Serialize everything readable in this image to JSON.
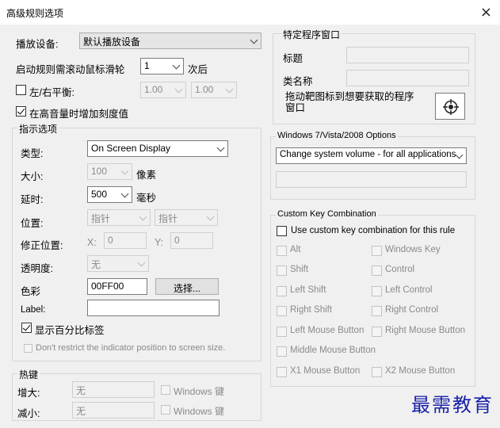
{
  "window": {
    "title": "高级规则选项",
    "close_glyph": "×"
  },
  "device": {
    "label": "播放设备:",
    "value": "默认播放设备"
  },
  "activation": {
    "prefix": "启动规则需滚动鼠标滑轮",
    "count": "1",
    "suffix": "次后"
  },
  "balance": {
    "label": "左/右平衡:",
    "checked": false,
    "left": "1.00",
    "right": "1.00"
  },
  "increase_scale": {
    "label": "在高音量时增加刻度值",
    "checked": true
  },
  "indicator": {
    "group_label": "指示选项",
    "type": {
      "label": "类型:",
      "value": "On Screen Display"
    },
    "size": {
      "label": "大小:",
      "value": "100",
      "unit": "像素"
    },
    "delay": {
      "label": "延时:",
      "value": "500",
      "unit": "毫秒"
    },
    "position": {
      "label": "位置:",
      "value1": "指针",
      "value2": "指针"
    },
    "fix_position": {
      "label": "修正位置:",
      "x_label": "X:",
      "x_value": "0",
      "y_label": "Y:",
      "y_value": "0"
    },
    "opacity": {
      "label": "透明度:",
      "value": "无"
    },
    "color": {
      "label": "色彩",
      "value": "00FF00",
      "button": "选择..."
    },
    "label_field": {
      "label": "Label:",
      "value": ""
    },
    "show_percent": {
      "label": "显示百分比标签",
      "checked": true
    },
    "no_restrict": {
      "label": "Don't restrict the indicator position to screen size.",
      "checked": false
    }
  },
  "hotkeys": {
    "group_label": "热键",
    "increase": {
      "label": "增大:",
      "value": "无",
      "win_label": "Windows 键"
    },
    "decrease": {
      "label": "减小:",
      "value": "无",
      "win_label": "Windows 键"
    }
  },
  "program_window": {
    "group_label": "特定程序窗口",
    "title_label": "标题",
    "title_value": "",
    "class_label": "类名称",
    "class_value": "",
    "drag_hint_line1": "拖动靶图标到想要获取的程序",
    "drag_hint_line2": "窗口",
    "crosshair_icon": "crosshair-target-icon"
  },
  "win7": {
    "group_label": "Windows 7/Vista/2008 Options",
    "value": "Change system volume - for all applications",
    "extra_value": ""
  },
  "custom_keys": {
    "group_label": "Custom Key Combination",
    "use_label": "Use custom key combination for this rule",
    "use_checked": false,
    "keys": [
      "Alt",
      "Windows Key",
      "Shift",
      "Control",
      "Left Shift",
      "Left Control",
      "Right Shift",
      "Right Control",
      "Left Mouse Button",
      "Right Mouse Button",
      "Middle Mouse Button",
      "X1 Mouse Button",
      "X2 Mouse Button"
    ]
  },
  "watermark": "最需教育",
  "colors": {
    "background": "#f0f0f0",
    "watermark": "#1a22a8"
  }
}
